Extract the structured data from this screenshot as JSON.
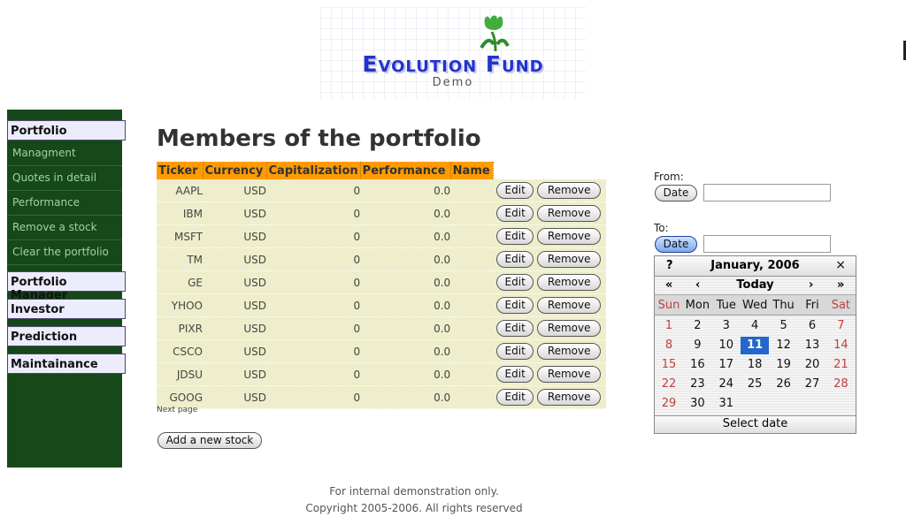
{
  "logo": {
    "title": "Evolution Fund",
    "subtitle": "Demo"
  },
  "sidebar": {
    "sections": [
      "Portfolio",
      "Portfolio Manager",
      "Investor",
      "Prediction",
      "Maintainance"
    ],
    "items": [
      "Managment",
      "Quotes in detail",
      "Performance",
      "Remove a stock",
      "Clear the portfolio"
    ]
  },
  "main": {
    "title": "Members of the portfolio",
    "headers": [
      "Ticker",
      "Currency",
      "Capitalization",
      "Performance",
      "Name"
    ],
    "rows": [
      {
        "ticker": "AAPL",
        "currency": "USD",
        "cap": "0",
        "perf": "0.0",
        "name": ""
      },
      {
        "ticker": "IBM",
        "currency": "USD",
        "cap": "0",
        "perf": "0.0",
        "name": ""
      },
      {
        "ticker": "MSFT",
        "currency": "USD",
        "cap": "0",
        "perf": "0.0",
        "name": ""
      },
      {
        "ticker": "TM",
        "currency": "USD",
        "cap": "0",
        "perf": "0.0",
        "name": ""
      },
      {
        "ticker": "GE",
        "currency": "USD",
        "cap": "0",
        "perf": "0.0",
        "name": ""
      },
      {
        "ticker": "YHOO",
        "currency": "USD",
        "cap": "0",
        "perf": "0.0",
        "name": ""
      },
      {
        "ticker": "PIXR",
        "currency": "USD",
        "cap": "0",
        "perf": "0.0",
        "name": ""
      },
      {
        "ticker": "CSCO",
        "currency": "USD",
        "cap": "0",
        "perf": "0.0",
        "name": ""
      },
      {
        "ticker": "JDSU",
        "currency": "USD",
        "cap": "0",
        "perf": "0.0",
        "name": ""
      },
      {
        "ticker": "GOOG",
        "currency": "USD",
        "cap": "0",
        "perf": "0.0",
        "name": ""
      }
    ],
    "edit_label": "Edit",
    "remove_label": "Remove",
    "next_page": "Next page",
    "add_stock": "Add a new stock"
  },
  "dates": {
    "from_label": "From:",
    "to_label": "To:",
    "button_label": "Date",
    "from_value": "",
    "to_value": ""
  },
  "calendar": {
    "help": "?",
    "month": "January, 2006",
    "close": "×",
    "prev_year": "«",
    "prev_month": "‹",
    "today": "Today",
    "next_month": "›",
    "next_year": "»",
    "days_of_week": [
      "Sun",
      "Mon",
      "Tue",
      "Wed",
      "Thu",
      "Fri",
      "Sat"
    ],
    "weeks": [
      [
        "1",
        "2",
        "3",
        "4",
        "5",
        "6",
        "7"
      ],
      [
        "8",
        "9",
        "10",
        "11",
        "12",
        "13",
        "14"
      ],
      [
        "15",
        "16",
        "17",
        "18",
        "19",
        "20",
        "21"
      ],
      [
        "22",
        "23",
        "24",
        "25",
        "26",
        "27",
        "28"
      ],
      [
        "29",
        "30",
        "31",
        "",
        "",
        "",
        ""
      ]
    ],
    "selected_day": "11",
    "footer": "Select date"
  },
  "footer": {
    "line1": "For internal demonstration only.",
    "line2": "Copyright 2005-2006. All rights reserved"
  },
  "colors": {
    "sidebar": "#16481a",
    "table_header": "#ff9b00",
    "row_bg": "#eeeecc",
    "selected_day": "#2366cc",
    "weekend": "#c04040"
  }
}
